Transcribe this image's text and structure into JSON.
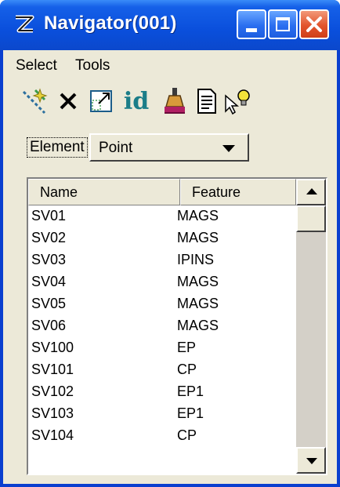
{
  "window": {
    "title": "Navigator(001)"
  },
  "menu": {
    "items": [
      "Select",
      "Tools"
    ]
  },
  "toolbar": {
    "icons": [
      "select-elements-icon",
      "delete-icon",
      "zoom-to-icon",
      "identify-icon",
      "highlight-brush-icon",
      "report-icon",
      "review-lightbulb-icon"
    ],
    "id_label": "id"
  },
  "element_filter": {
    "label": "Element",
    "value": "Point"
  },
  "table": {
    "headers": {
      "name": "Name",
      "feature": "Feature"
    },
    "rows": [
      {
        "name": "SV01",
        "feature": "MAGS"
      },
      {
        "name": "SV02",
        "feature": "MAGS"
      },
      {
        "name": "SV03",
        "feature": "IPINS"
      },
      {
        "name": "SV04",
        "feature": "MAGS"
      },
      {
        "name": "SV05",
        "feature": "MAGS"
      },
      {
        "name": "SV06",
        "feature": "MAGS"
      },
      {
        "name": "SV100",
        "feature": "EP"
      },
      {
        "name": "SV101",
        "feature": "CP"
      },
      {
        "name": "SV102",
        "feature": "EP1"
      },
      {
        "name": "SV103",
        "feature": "EP1"
      },
      {
        "name": "SV104",
        "feature": "CP"
      }
    ]
  },
  "colors": {
    "titlebar": "#0a4fdc",
    "close_button": "#e2542c",
    "window_face": "#ece9d8"
  }
}
